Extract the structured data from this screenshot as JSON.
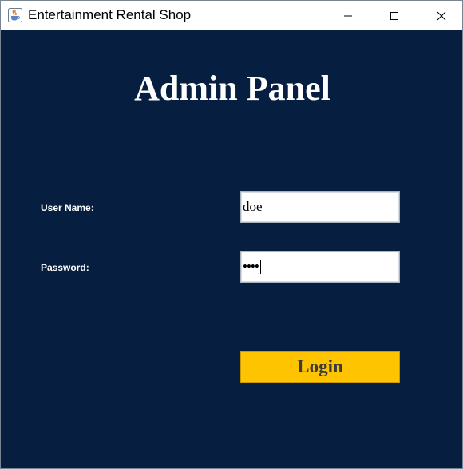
{
  "window": {
    "title": "Entertainment Rental Shop",
    "app_icon": "java-cup-icon",
    "background_color": "#061e40"
  },
  "panel": {
    "heading": "Admin Panel"
  },
  "form": {
    "username_label": "User Name:",
    "username_value": "doe",
    "password_label": "Password:",
    "password_mask": "••••",
    "login_label": "Login",
    "login_color": "#ffc400"
  }
}
